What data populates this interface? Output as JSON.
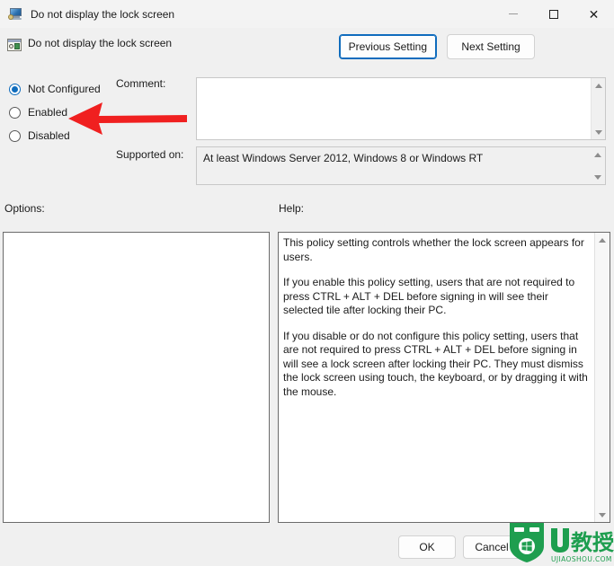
{
  "window": {
    "title": "Do not display the lock screen",
    "icon": "monitor-policy-icon",
    "minimize_label": "–",
    "maximize_label": "□",
    "close_label": "✕"
  },
  "header": {
    "policy_name": "Do not display the lock screen",
    "policy_icon": "group-policy-setting-icon",
    "previous_setting_label": "Previous Setting",
    "next_setting_label": "Next Setting"
  },
  "state": {
    "options": [
      {
        "label": "Not Configured",
        "selected": true
      },
      {
        "label": "Enabled",
        "selected": false
      },
      {
        "label": "Disabled",
        "selected": false
      }
    ]
  },
  "comment": {
    "label": "Comment:",
    "value": "",
    "placeholder": ""
  },
  "supported": {
    "label": "Supported on:",
    "value": "At least Windows Server 2012, Windows 8 or Windows RT"
  },
  "panels": {
    "options_label": "Options:",
    "options_content": "",
    "help_label": "Help:",
    "help_paragraphs": [
      "This policy setting controls whether the lock screen appears for users.",
      "If you enable this policy setting, users that are not required to press CTRL + ALT + DEL before signing in will see their selected tile after locking their PC.",
      "If you disable or do not configure this policy setting, users that are not required to press CTRL + ALT + DEL before signing in will see a lock screen after locking their PC. They must dismiss the lock screen using touch, the keyboard, or by dragging it with the mouse."
    ]
  },
  "footer": {
    "ok_label": "OK",
    "cancel_label": "Cancel"
  },
  "annotation": {
    "arrow_color": "#f02020",
    "arrow_points_to": "Enabled"
  },
  "watermark": {
    "brand": "U教授",
    "domain": "UJIAOSHOU.COM",
    "color": "#1e9e4f"
  },
  "colors": {
    "window_background": "#f0f0f0",
    "titlebar_background": "#f3f3f3",
    "accent": "#0f6cbd",
    "panel_border": "#6b6b6b",
    "text": "#1b1b1b"
  }
}
